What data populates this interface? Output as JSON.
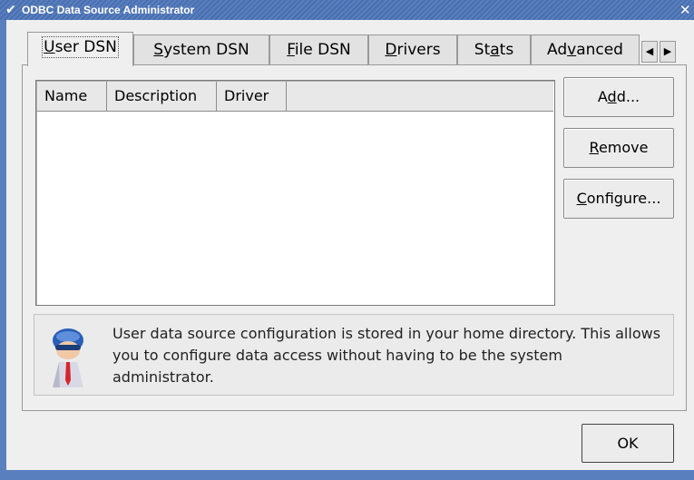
{
  "window": {
    "title": "ODBC Data Source Administrator"
  },
  "tabs": [
    {
      "label": "User DSN",
      "mnemonic": "U",
      "active": true
    },
    {
      "label": "System DSN",
      "mnemonic": "S"
    },
    {
      "label": "File DSN",
      "mnemonic": "F"
    },
    {
      "label": "Drivers",
      "mnemonic": "D"
    },
    {
      "label": "Stats",
      "mnemonic": "a"
    },
    {
      "label": "Advanced",
      "mnemonic": "v"
    }
  ],
  "tab_scroll": {
    "left_icon": "arrow-left-icon",
    "right_icon": "arrow-right-icon"
  },
  "dsn_list": {
    "columns": [
      "Name",
      "Description",
      "Driver",
      ""
    ],
    "rows": []
  },
  "buttons": {
    "add": "Add...",
    "remove": "Remove",
    "configure": "Configure...",
    "ok": "OK"
  },
  "info": {
    "text": "User data source configuration is stored in your home directory. This allows you to configure data access without having to be the system administrator.",
    "icon": "user-icon"
  },
  "colors": {
    "titlebar": "#5a7fbf",
    "background": "#efefef"
  }
}
